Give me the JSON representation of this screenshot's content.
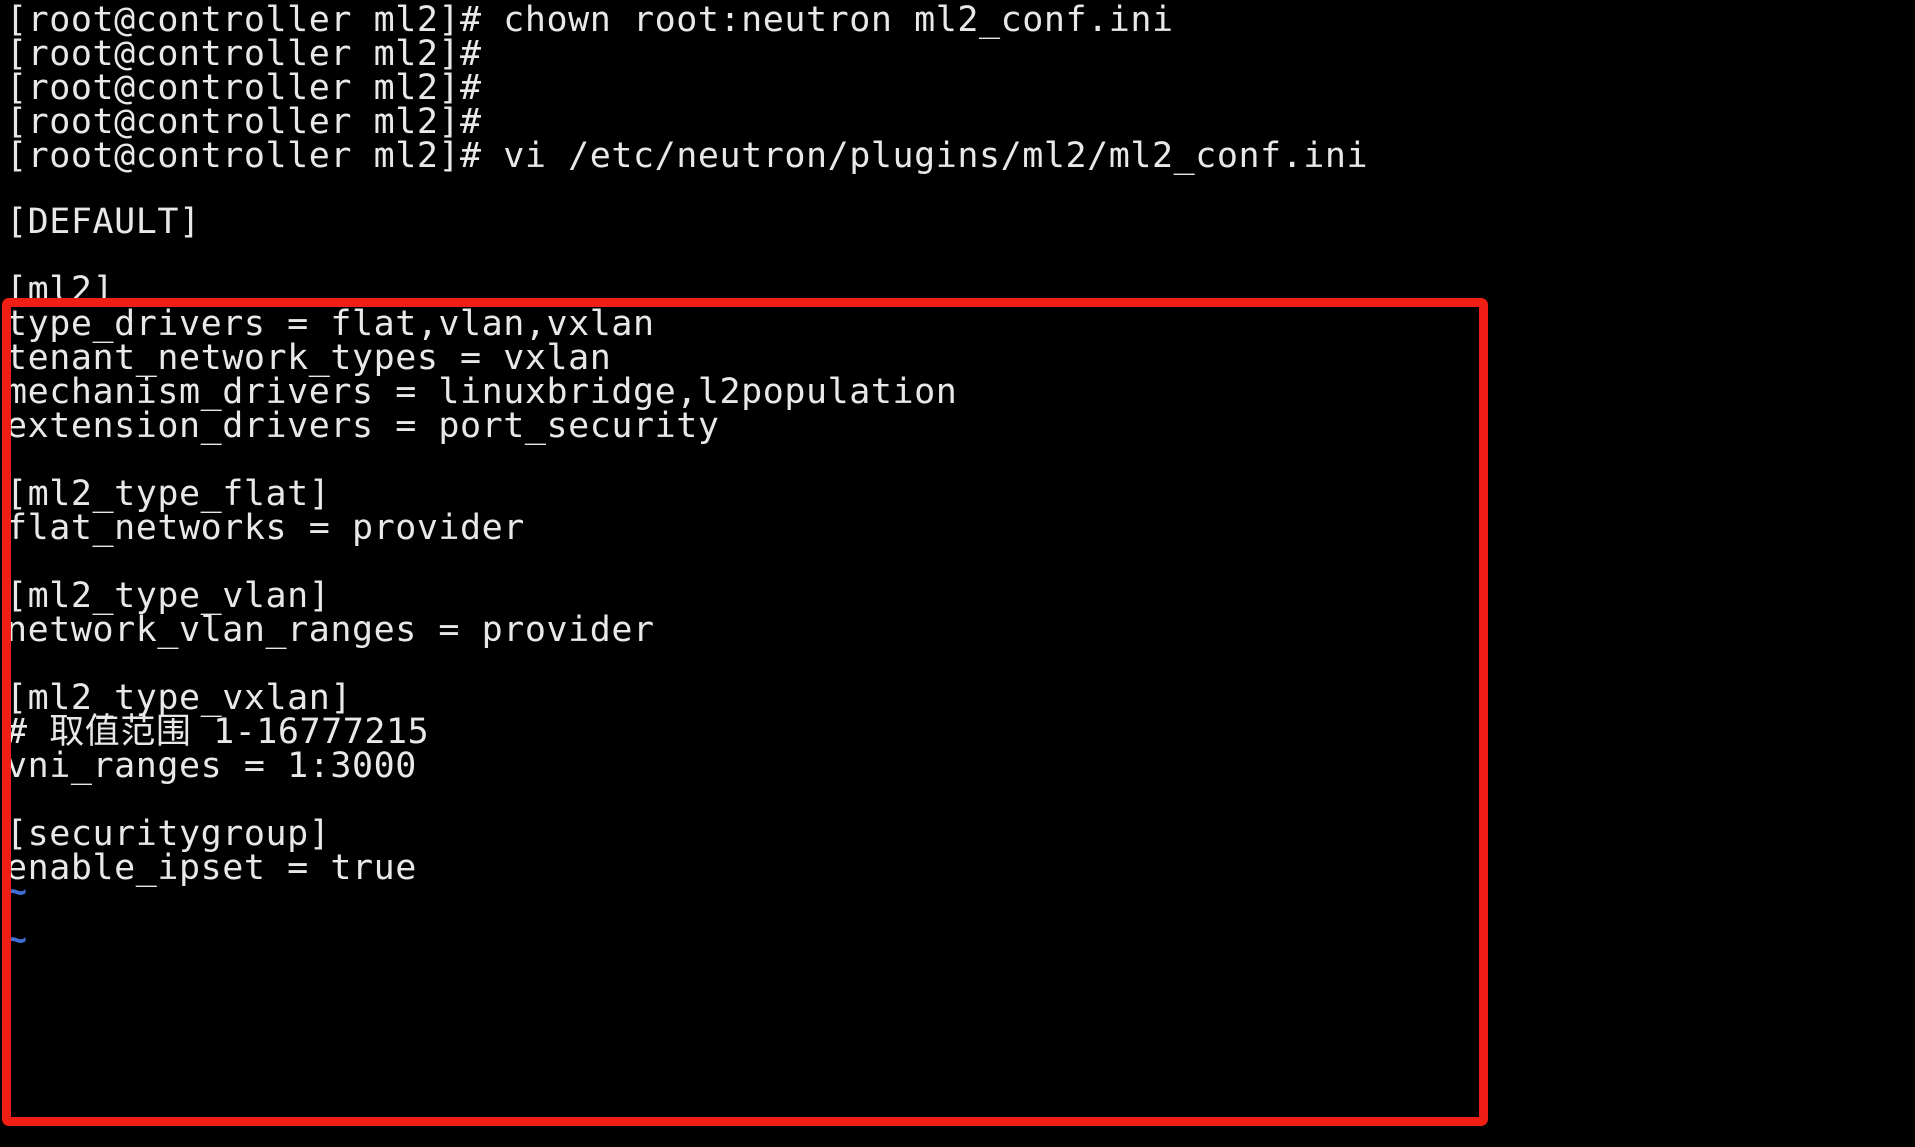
{
  "terminal": {
    "background_color": "#000000",
    "text_color": "#e8e8e8",
    "tilde_color": "#3f6fd6",
    "prompt_lines": [
      "[root@controller ml2]# chown root:neutron ml2_conf.ini",
      "[root@controller ml2]#",
      "[root@controller ml2]#",
      "[root@controller ml2]#",
      "[root@controller ml2]# vi /etc/neutron/plugins/ml2/ml2_conf.ini"
    ],
    "default_section": "[DEFAULT]",
    "config_lines": [
      "",
      "[ml2]",
      "type_drivers = flat,vlan,vxlan",
      "tenant_network_types = vxlan",
      "mechanism_drivers = linuxbridge,l2population",
      "extension_drivers = port_security",
      "",
      "[ml2_type_flat]",
      "flat_networks = provider",
      "",
      "[ml2_type_vlan]",
      "network_vlan_ranges = provider",
      "",
      "[ml2_type_vxlan]",
      "# 取值范围 1-16777215",
      "vni_ranges = 1:3000",
      "",
      "[securitygroup]",
      "enable_ipset = true"
    ],
    "vim_empty_markers": [
      "~",
      "~"
    ]
  },
  "annotation": {
    "color": "#f01e14",
    "border_width_px": 9,
    "shape": "rectangle"
  }
}
